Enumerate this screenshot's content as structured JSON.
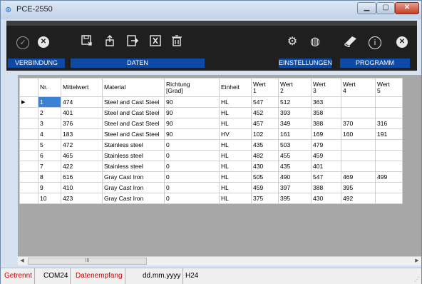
{
  "window": {
    "title": "PCE-2550"
  },
  "toolbar": {
    "groups": {
      "connection": "VERBINDUNG",
      "data": "DATEN",
      "settings": "EINSTELLUNGEN",
      "program": "PROGRAMM"
    }
  },
  "table": {
    "columns": [
      "Nr.",
      "Mittelwert",
      "Material",
      "Richtung\n[Grad]",
      "Einheit",
      "Wert\n1",
      "Wert\n2",
      "Wert\n3",
      "Wert\n4",
      "Wert\n5"
    ],
    "rows": [
      [
        "1",
        "474",
        "Steel and Cast Steel",
        "90",
        "HL",
        "547",
        "512",
        "363",
        "",
        ""
      ],
      [
        "2",
        "401",
        "Steel and Cast Steel",
        "90",
        "HL",
        "452",
        "393",
        "358",
        "",
        ""
      ],
      [
        "3",
        "376",
        "Steel and Cast Steel",
        "90",
        "HL",
        "457",
        "349",
        "388",
        "370",
        "316"
      ],
      [
        "4",
        "183",
        "Steel and Cast Steel",
        "90",
        "HV",
        "102",
        "161",
        "169",
        "160",
        "191"
      ],
      [
        "5",
        "472",
        "Stainless steel",
        "0",
        "HL",
        "435",
        "503",
        "479",
        "",
        ""
      ],
      [
        "6",
        "465",
        "Stainless steel",
        "0",
        "HL",
        "482",
        "455",
        "459",
        "",
        ""
      ],
      [
        "7",
        "422",
        "Stainless steel",
        "0",
        "HL",
        "430",
        "435",
        "401",
        "",
        ""
      ],
      [
        "8",
        "616",
        "Gray Cast Iron",
        "0",
        "HL",
        "505",
        "490",
        "547",
        "469",
        "499"
      ],
      [
        "9",
        "410",
        "Gray Cast Iron",
        "0",
        "HL",
        "459",
        "397",
        "388",
        "395",
        ""
      ],
      [
        "10",
        "423",
        "Gray Cast Iron",
        "0",
        "HL",
        "375",
        "395",
        "430",
        "492",
        ""
      ]
    ]
  },
  "scrollbar": {
    "thumb_label": "III"
  },
  "status": {
    "connection": "Getrennt",
    "port": "COM24",
    "receive": "Datenempfang",
    "date_format": "dd.mm.yyyy",
    "time_format": "H24"
  },
  "colors": {
    "accent": "#0c4aa6",
    "selection": "#3b82d6",
    "status_red": "#d00000",
    "toolbar_bg": "#1f1f1f"
  }
}
